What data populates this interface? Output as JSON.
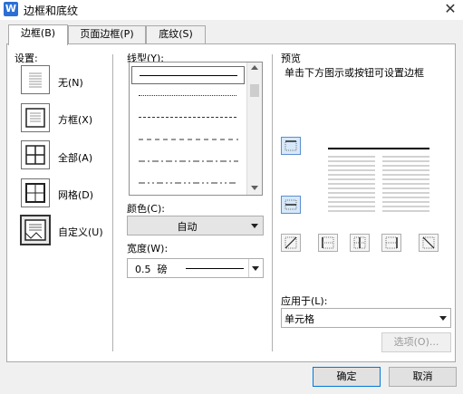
{
  "window": {
    "title": "边框和底纹",
    "app_icon_letter": "W"
  },
  "tabs": [
    {
      "label": "边框(B)",
      "active": true
    },
    {
      "label": "页面边框(P)",
      "active": false
    },
    {
      "label": "底纹(S)",
      "active": false
    }
  ],
  "settings": {
    "label": "设置:",
    "items": [
      {
        "label": "无(N)",
        "icon": "none-border-icon"
      },
      {
        "label": "方框(X)",
        "icon": "box-border-icon"
      },
      {
        "label": "全部(A)",
        "icon": "all-border-icon"
      },
      {
        "label": "网格(D)",
        "icon": "grid-border-icon"
      },
      {
        "label": "自定义(U)",
        "icon": "custom-border-icon",
        "selected": true
      }
    ]
  },
  "style": {
    "label": "线型(Y):",
    "options": [
      "solid",
      "dotted",
      "dashed-small",
      "dashed",
      "dash-dot",
      "dash-dot-dot"
    ]
  },
  "color": {
    "label": "颜色(C):",
    "value": "自动"
  },
  "width": {
    "label": "宽度(W):",
    "value": "0.5  磅"
  },
  "preview": {
    "label": "预览",
    "hint": "单击下方图示或按钮可设置边框"
  },
  "apply_to": {
    "label": "应用于(L):",
    "value": "单元格"
  },
  "buttons": {
    "options": "选项(O)...",
    "ok": "确定",
    "cancel": "取消"
  },
  "colors": {
    "accent": "#2b6fd6",
    "highlight": "#d6e8fa"
  }
}
